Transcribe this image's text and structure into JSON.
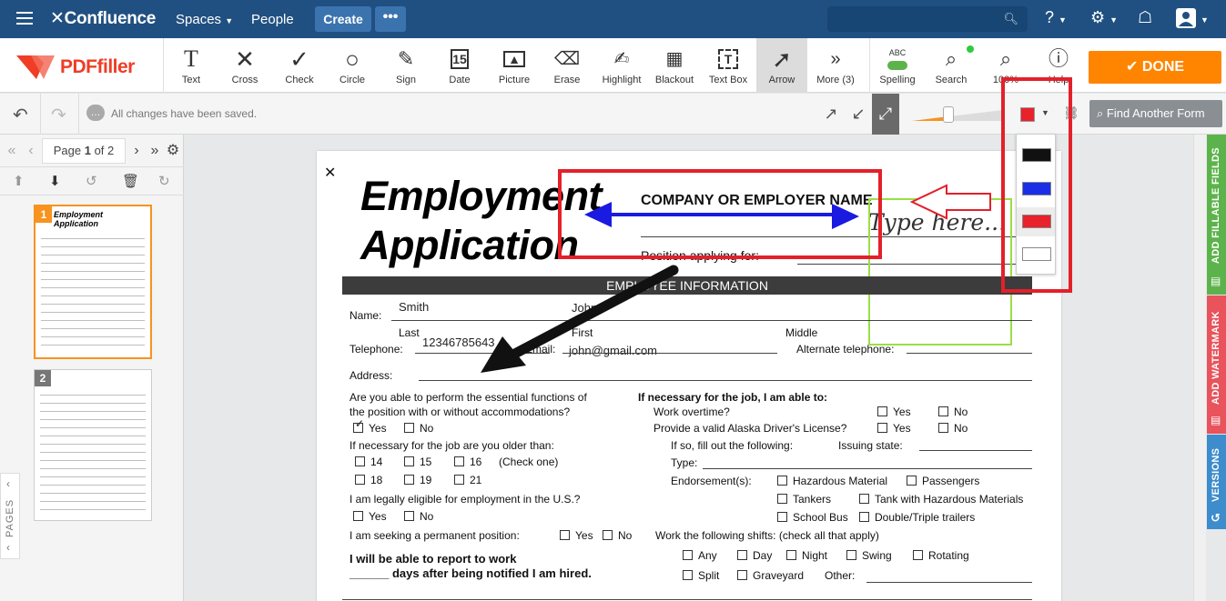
{
  "confluence": {
    "logo": "Confluence",
    "nav": [
      "Spaces",
      "People"
    ],
    "create": "Create",
    "more": "•••"
  },
  "toolbar": {
    "brand": "PDFfiller",
    "tools": [
      {
        "label": "Text",
        "icon": "text-icon"
      },
      {
        "label": "Cross",
        "icon": "cross-icon"
      },
      {
        "label": "Check",
        "icon": "check-icon"
      },
      {
        "label": "Circle",
        "icon": "circle-icon"
      },
      {
        "label": "Sign",
        "icon": "pen-icon"
      },
      {
        "label": "Date",
        "icon": "calendar-icon"
      },
      {
        "label": "Picture",
        "icon": "picture-icon"
      },
      {
        "label": "Erase",
        "icon": "eraser-icon"
      },
      {
        "label": "Highlight",
        "icon": "highlight-icon"
      },
      {
        "label": "Blackout",
        "icon": "blackout-icon"
      },
      {
        "label": "Text Box",
        "icon": "textbox-icon"
      },
      {
        "label": "Arrow",
        "icon": "arrow-icon"
      },
      {
        "label": "More (3)",
        "icon": "more-icon"
      }
    ],
    "spelling": "Spelling",
    "spelling_badge": "ABC",
    "search": "Search",
    "zoom": "100%",
    "help": "Help",
    "done": "DONE"
  },
  "subbar": {
    "saved": "All changes have been saved.",
    "find_form": "Find Another Form"
  },
  "pager": {
    "label_prefix": "Page",
    "current": "1",
    "label_mid": "of",
    "total": "2"
  },
  "thumbnails": [
    "1",
    "2"
  ],
  "pages_tab": "PAGES",
  "right_tabs": [
    "ADD FILLABLE FIELDS",
    "ADD WATERMARK",
    "VERSIONS"
  ],
  "colors": {
    "confluence": "#205081",
    "done": "#ff8500",
    "swatches": [
      "#111111",
      "#1a2ee8",
      "#e8212b",
      "#ffffff"
    ],
    "tab_green": "#5db34b",
    "tab_red": "#e8535c",
    "tab_blue": "#3d8ccc"
  },
  "document": {
    "title_line1": "Employment",
    "title_line2": "Application",
    "company_label": "COMPANY OR EMPLOYER NAME",
    "position_label": "Position applying for:",
    "type_here": "Type here...",
    "section": "EMPLOYEE INFORMATION",
    "name_label": "Name:",
    "name_last_value": "Smith",
    "name_first_value": "John",
    "last": "Last",
    "first": "First",
    "middle": "Middle",
    "telephone_label": "Telephone:",
    "telephone_value": "12346785643",
    "email_label": "Email:",
    "email_value": "john@gmail.com",
    "alt_phone": "Alternate telephone:",
    "address_label": "Address:",
    "q1_line1": "Are you able to perform the essential functions of",
    "q1_line2": "the position with or without accommodations?",
    "yes": "Yes",
    "no": "No",
    "q_older": "If necessary for the job are you older than:",
    "ages": [
      "14",
      "15",
      "16",
      "18",
      "19",
      "21"
    ],
    "check_one": "(Check one)",
    "q_legal": "I am legally eligible for employment in the U.S.?",
    "q_perm": "I am seeking a permanent position:",
    "report_line1": "I will be able to report to work",
    "report_line2": "______ days after being notified I am hired.",
    "r_head": "If necessary for the job, I am able to:",
    "r_overtime": "Work overtime?",
    "r_license": "Provide a valid Alaska Driver's License?",
    "r_fill": "If so, fill out the following:",
    "r_issuing": "Issuing state:",
    "r_type": "Type:",
    "r_endorse": "Endorsement(s):",
    "endorsements": [
      "Hazardous Material",
      "Passengers",
      "Tankers",
      "Tank with Hazardous Materials",
      "School Bus",
      "Double/Triple trailers"
    ],
    "r_shifts": "Work the following shifts: (check all that apply)",
    "shifts": [
      "Any",
      "Day",
      "Night",
      "Swing",
      "Rotating",
      "Split",
      "Graveyard"
    ],
    "other": "Other:"
  }
}
